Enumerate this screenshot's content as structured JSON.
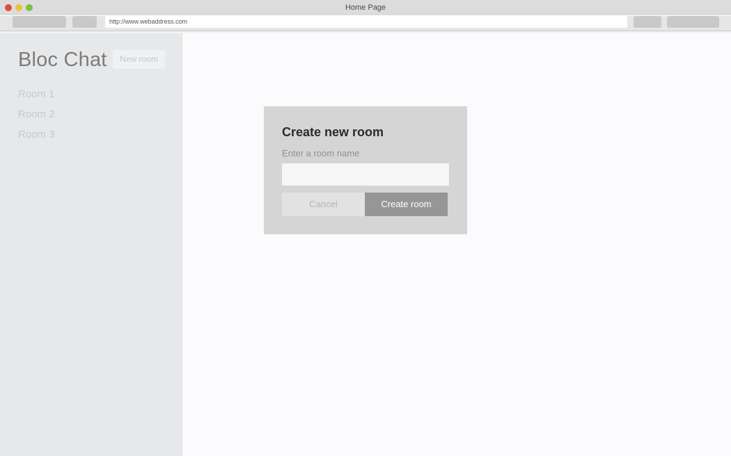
{
  "window": {
    "title": "Home Page",
    "traffic_lights": [
      {
        "name": "close",
        "color": "#e24b3a"
      },
      {
        "name": "minimize",
        "color": "#e8c33c"
      },
      {
        "name": "maximize",
        "color": "#7ec13d"
      }
    ]
  },
  "toolbar": {
    "back_label": "",
    "forward_label": "",
    "extra_button_1_label": "",
    "extra_button_2_label": "",
    "url_value": "http://www.webaddress.com",
    "url_placeholder": "http://www.webaddress.com"
  },
  "sidebar": {
    "brand": "Bloc Chat",
    "new_room_label": "New room",
    "rooms": [
      {
        "label": "Room 1"
      },
      {
        "label": "Room 2"
      },
      {
        "label": "Room 3"
      }
    ]
  },
  "modal": {
    "title": "Create new room",
    "field_label": "Enter a room name",
    "input_value": "",
    "input_placeholder": "",
    "cancel_label": "Cancel",
    "submit_label": "Create room"
  },
  "colors": {
    "titlebar": "#dcdcdc",
    "toolbar": "#e6e6e6",
    "sidebar": "#e7e8e9",
    "content": "#fbfbfd",
    "modal": "#d5d5d5",
    "submit_button": "#969696",
    "cancel_button": "#e2e2e2"
  }
}
